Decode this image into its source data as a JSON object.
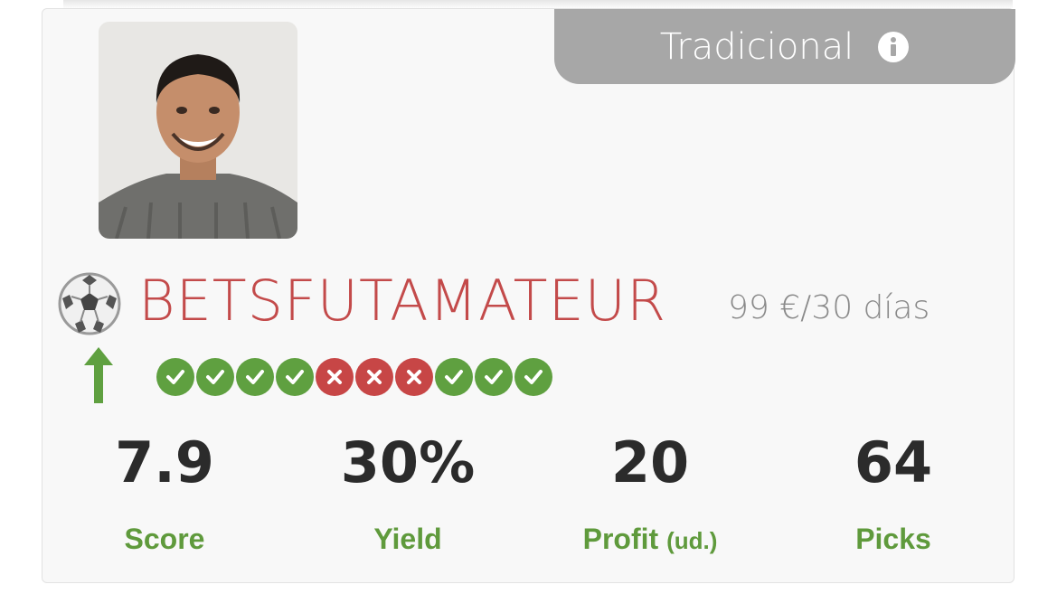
{
  "category_tab": {
    "label": "Tradicional",
    "icon": "info-icon"
  },
  "tipster": {
    "name": "BETSFUTAMATEUR",
    "sport_icon": "soccer-ball-icon",
    "price": "99 €/30 días",
    "trend_icon": "up-arrow-icon"
  },
  "streak": [
    "win",
    "win",
    "win",
    "win",
    "loss",
    "loss",
    "loss",
    "win",
    "win",
    "win"
  ],
  "stats": {
    "score": {
      "value": "7.9",
      "label": "Score"
    },
    "yield": {
      "value": "30%",
      "label": "Yield"
    },
    "profit": {
      "value": "20",
      "label": "Profit",
      "unit": "(ud.)"
    },
    "picks": {
      "value": "64",
      "label": "Picks"
    }
  },
  "colors": {
    "win": "#5fa040",
    "loss": "#c74646",
    "name": "#c34a4a",
    "label": "#5f9a3c",
    "tab": "#a7a7a7"
  }
}
